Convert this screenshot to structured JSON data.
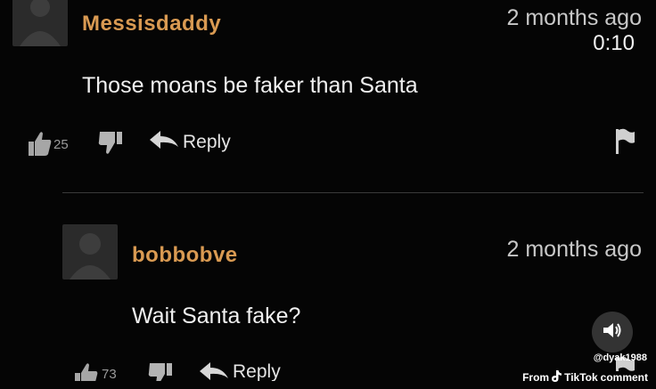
{
  "video": {
    "elapsed": "0:10"
  },
  "comments": [
    {
      "username": "Messisdaddy",
      "timestamp": "2 months ago",
      "text": "Those moans be faker than Santa",
      "likes": "25",
      "reply_label": "Reply"
    },
    {
      "username": "bobbobve",
      "timestamp": "2 months ago",
      "text": "Wait Santa fake?",
      "likes": "73",
      "reply_label": "Reply"
    }
  ],
  "tiktok": {
    "handle": "@dyak1988",
    "from_label": "From",
    "brand": "TikTok",
    "suffix": "comment"
  },
  "icons": {
    "like": "thumbs-up-icon",
    "dislike": "thumbs-down-icon",
    "reply": "reply-arrow-icon",
    "flag": "flag-icon",
    "sound": "speaker-icon",
    "tiktok": "tiktok-note-icon"
  },
  "colors": {
    "background": "#050505",
    "username": "#d99a52",
    "text": "#f0f0f0",
    "muted": "#c8c8c8"
  }
}
